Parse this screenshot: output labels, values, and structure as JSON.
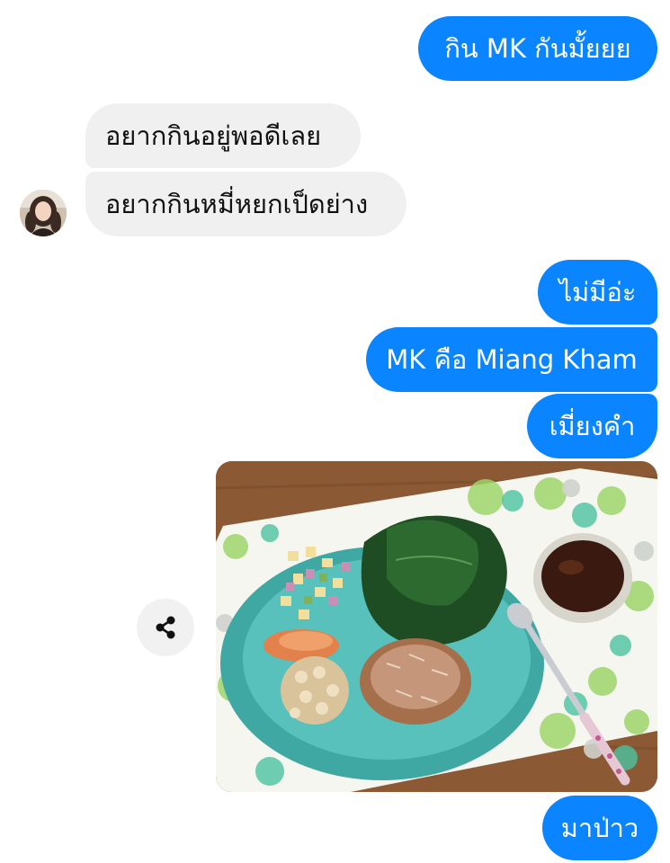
{
  "conversation": {
    "messages": [
      {
        "sender": "me",
        "text": "กิน MK กันมั้ยยย"
      },
      {
        "sender": "friend",
        "text": "อยากกินอยู่พอดีเลย"
      },
      {
        "sender": "friend",
        "text": "อยากกินหมี่หยกเป็ดย่าง"
      },
      {
        "sender": "me",
        "text": "ไม่มีอ่ะ"
      },
      {
        "sender": "me",
        "text": "MK คือ Miang Kham"
      },
      {
        "sender": "me",
        "text": "เมี่ยงคำ"
      },
      {
        "sender": "me",
        "type": "photo",
        "subject": "miang-kham-plate"
      },
      {
        "sender": "me",
        "text": "มาป่าว"
      }
    ],
    "share_icon": "share-icon",
    "avatar_icon": "friend-avatar",
    "colors": {
      "outgoing_bubble": "#0a84ff",
      "incoming_bubble": "#f0f0f0",
      "background": "#ffffff"
    }
  }
}
